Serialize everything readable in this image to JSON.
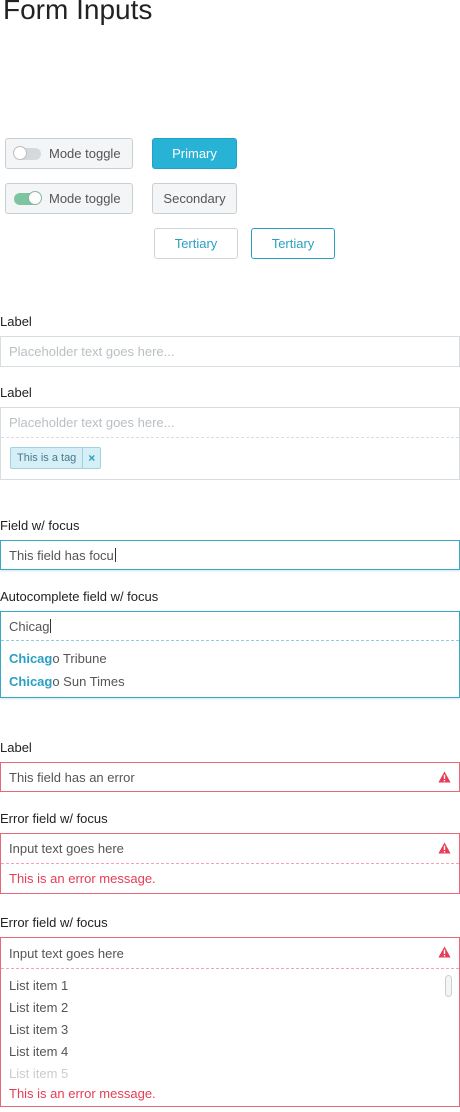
{
  "page": {
    "title": "Form Inputs"
  },
  "buttons": {
    "toggle_off": "Mode toggle",
    "toggle_on": "Mode toggle",
    "primary": "Primary",
    "secondary": "Secondary",
    "tertiary_a": "Tertiary",
    "tertiary_b": "Tertiary"
  },
  "field1": {
    "label": "Label",
    "placeholder": "Placeholder text goes here..."
  },
  "field2": {
    "label": "Label",
    "placeholder": "Placeholder text goes here...",
    "tag": "This is a tag"
  },
  "focus_field": {
    "label": "Field w/ focus",
    "value": "This field has focu"
  },
  "autocomplete": {
    "label": "Autocomplete field w/ focus",
    "value": "Chicag",
    "suggestions": [
      {
        "match": "Chicag",
        "rest": "o Tribune"
      },
      {
        "match": "Chicag",
        "rest": "o Sun Times"
      }
    ]
  },
  "error_field": {
    "label": "Label",
    "value": "This field has an error"
  },
  "error_focus": {
    "label": "Error field w/ focus",
    "value": "Input text goes here",
    "message": "This is an error message."
  },
  "error_list": {
    "label": "Error field w/ focus",
    "value": "Input text goes here",
    "items": [
      "List item 1",
      "List item 2",
      "List item 3",
      "List item 4",
      "List item 5"
    ],
    "message": "This is an error message."
  },
  "colors": {
    "accent": "#27b2d6",
    "error": "#e53d55",
    "toggle_on": "#7cc5a0"
  }
}
